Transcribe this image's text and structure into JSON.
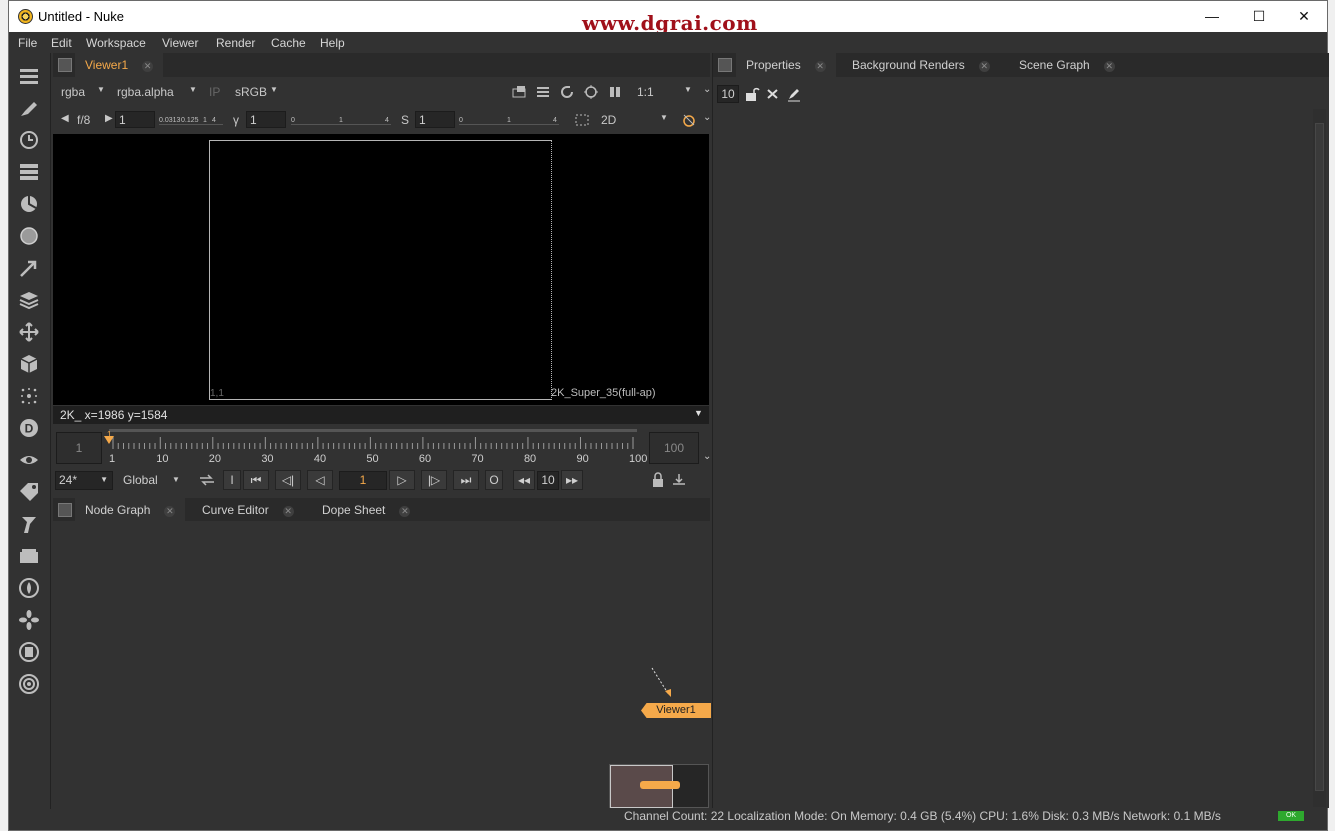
{
  "window": {
    "title": "Untitled - Nuke",
    "watermark": "www.dgrai.com",
    "minimize": "—",
    "maximize": "☐",
    "close": "✕"
  },
  "menu": [
    "File",
    "Edit",
    "Workspace",
    "Viewer",
    "Render",
    "Cache",
    "Help"
  ],
  "left_toolbar": [
    "image-io-icon",
    "draw-icon",
    "time-icon",
    "channel-icon",
    "color-icon",
    "filter-icon",
    "keyer-icon",
    "merge-icon",
    "transform-icon",
    "3d-icon",
    "particles-icon",
    "deep-icon",
    "views-icon",
    "metadata-icon",
    "toolsets-icon",
    "other-icon",
    "furnace-icon",
    "ocula-icon",
    "cara-icon",
    "nukex-icon"
  ],
  "viewer_panel": {
    "tab": "Viewer1",
    "channels": "rgba",
    "alpha": "rgba.alpha",
    "ip": "IP",
    "lut": "sRGB",
    "zoom": "1:1",
    "fstop_label": "f/8",
    "gain": "1",
    "gain_ticks": [
      "0.0313",
      "0.125",
      "1",
      "4"
    ],
    "gamma_label": "γ",
    "gamma": "1",
    "gamma_ticks": [
      "0",
      "1",
      "4"
    ],
    "sat_label": "S",
    "sat": "1",
    "sat_ticks": [
      "0",
      "1",
      "4"
    ],
    "view_mode": "2D",
    "corner_label": "1,1",
    "format_label": "2K_Super_35(full-ap)",
    "info_bar": "2K_  x=1986 y=1584"
  },
  "timeline": {
    "in_frame": "1",
    "out_frame": "100",
    "current_marker": "1",
    "ticks": [
      "1",
      "10",
      "20",
      "30",
      "40",
      "50",
      "60",
      "70",
      "80",
      "90",
      "100"
    ],
    "fps": "24*",
    "range": "Global",
    "frame": "1",
    "increment": "10",
    "in_label": "I",
    "out_label": "O"
  },
  "bottom_tabs": [
    "Node Graph",
    "Curve Editor",
    "Dope Sheet"
  ],
  "node_graph": {
    "node_label": "Viewer1"
  },
  "right_tabs": [
    "Properties",
    "Background Renders",
    "Scene Graph"
  ],
  "properties": {
    "max_panels": "10"
  },
  "status": {
    "text": "Channel Count: 22  Localization Mode: On  Memory: 0.4 GB (5.4%)  CPU: 1.6%  Disk: 0.3 MB/s  Network: 0.1 MB/s",
    "badge": "OK"
  },
  "colors": {
    "accent": "#f5a94a",
    "background": "#323232",
    "viewer": "#000000",
    "watermark": "#a0101a"
  }
}
